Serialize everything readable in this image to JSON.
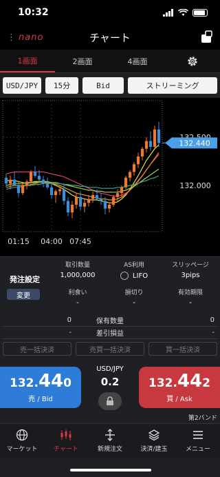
{
  "status": {
    "time": "10:32"
  },
  "header": {
    "logo": "nano",
    "title": "チャート"
  },
  "tabs": [
    {
      "label": "1画面"
    },
    {
      "label": "2画面"
    },
    {
      "label": "4画面"
    }
  ],
  "controls": {
    "pair": "USD/JPY",
    "interval": "15分",
    "price_type": "Bid",
    "streaming": "ストリーミング"
  },
  "chart_data": {
    "type": "candlestick",
    "y_tick_labels": [
      "132.500",
      "132.000"
    ],
    "y_ticks": [
      132.5,
      132.0
    ],
    "x_tick_labels": [
      "01:15",
      "04:00",
      "07:45"
    ],
    "current_price": "132.440",
    "ylim": [
      131.55,
      132.85
    ],
    "candles": [
      [
        132.08,
        132.12,
        131.98,
        132.02
      ],
      [
        132.02,
        132.1,
        131.96,
        132.06
      ],
      [
        132.06,
        132.14,
        132.0,
        132.0
      ],
      [
        132.0,
        132.04,
        131.88,
        131.92
      ],
      [
        131.92,
        132.02,
        131.9,
        132.0
      ],
      [
        132.0,
        132.06,
        131.96,
        132.04
      ],
      [
        132.04,
        132.16,
        132.02,
        132.14
      ],
      [
        132.14,
        132.2,
        132.08,
        132.1
      ],
      [
        132.1,
        132.16,
        132.04,
        132.06
      ],
      [
        132.06,
        132.1,
        131.98,
        132.02
      ],
      [
        132.02,
        132.08,
        131.96,
        131.98
      ],
      [
        131.98,
        132.02,
        131.86,
        131.9
      ],
      [
        131.9,
        131.96,
        131.82,
        131.94
      ],
      [
        131.94,
        132.0,
        131.9,
        131.96
      ],
      [
        131.96,
        132.02,
        131.8,
        131.84
      ],
      [
        131.84,
        131.88,
        131.68,
        131.72
      ],
      [
        131.72,
        131.84,
        131.66,
        131.8
      ],
      [
        131.8,
        131.92,
        131.76,
        131.88
      ],
      [
        131.88,
        131.94,
        131.74,
        131.78
      ],
      [
        131.78,
        131.86,
        131.72,
        131.82
      ],
      [
        131.82,
        131.9,
        131.78,
        131.86
      ],
      [
        131.86,
        131.94,
        131.82,
        131.9
      ],
      [
        131.9,
        131.96,
        131.84,
        131.86
      ],
      [
        131.86,
        131.92,
        131.8,
        131.84
      ],
      [
        131.84,
        131.88,
        131.7,
        131.76
      ],
      [
        131.76,
        131.82,
        131.72,
        131.8
      ],
      [
        131.8,
        131.9,
        131.78,
        131.88
      ],
      [
        131.88,
        131.96,
        131.84,
        131.92
      ],
      [
        131.92,
        132.0,
        131.88,
        131.98
      ],
      [
        131.98,
        132.1,
        131.96,
        132.08
      ],
      [
        132.08,
        132.16,
        132.04,
        132.14
      ],
      [
        132.14,
        132.24,
        132.1,
        132.22
      ],
      [
        132.22,
        132.34,
        132.18,
        132.3
      ],
      [
        132.3,
        132.4,
        132.26,
        132.38
      ],
      [
        132.38,
        132.5,
        132.34,
        132.46
      ],
      [
        132.46,
        132.56,
        132.36,
        132.4
      ],
      [
        132.4,
        132.62,
        132.38,
        132.58
      ],
      [
        132.58,
        132.66,
        132.4,
        132.44
      ]
    ],
    "ma_series": [
      {
        "color": "#e8e04a",
        "values": [
          132.05,
          132.05,
          132.05,
          132.04,
          132.03,
          132.02,
          132.03,
          132.04,
          132.04,
          132.04,
          132.03,
          132.02,
          132.0,
          131.98,
          131.96,
          131.93,
          131.9,
          131.88,
          131.87,
          131.86,
          131.85,
          131.85,
          131.85,
          131.84,
          131.83,
          131.82,
          131.82,
          131.83,
          131.86,
          131.9,
          131.96,
          132.03,
          132.1,
          132.18,
          132.26,
          132.32,
          132.38,
          132.42
        ]
      },
      {
        "color": "#e03a7a",
        "values": [
          132.12,
          132.13,
          132.14,
          132.14,
          132.14,
          132.14,
          132.14,
          132.14,
          132.14,
          132.14,
          132.13,
          132.12,
          132.11,
          132.1,
          132.09,
          132.07,
          132.05,
          132.03,
          132.01,
          131.99,
          131.97,
          131.95,
          131.93,
          131.92,
          131.91,
          131.9,
          131.89,
          131.89,
          131.9,
          131.92,
          131.95,
          131.99,
          132.04,
          132.1,
          132.16,
          132.22,
          132.27,
          132.32
        ]
      },
      {
        "color": "#e8942a",
        "values": [
          131.98,
          131.99,
          132.0,
          132.0,
          132.0,
          132.0,
          132.01,
          132.02,
          132.03,
          132.03,
          132.03,
          132.02,
          132.01,
          132.0,
          131.98,
          131.96,
          131.94,
          131.92,
          131.91,
          131.9,
          131.89,
          131.88,
          131.87,
          131.86,
          131.86,
          131.85,
          131.85,
          131.86,
          131.88,
          131.91,
          131.95,
          132.0,
          132.05,
          132.1,
          132.16,
          132.22,
          132.28,
          132.34
        ]
      },
      {
        "color": "#9ad84a",
        "values": [
          132.0,
          132.01,
          132.02,
          132.02,
          132.02,
          132.03,
          132.03,
          132.03,
          132.04,
          132.04,
          132.04,
          132.03,
          132.03,
          132.02,
          132.01,
          132.0,
          131.99,
          131.98,
          131.97,
          131.96,
          131.95,
          131.95,
          131.94,
          131.94,
          131.93,
          131.93,
          131.93,
          131.93,
          131.94,
          131.95,
          131.97,
          131.99,
          132.02,
          132.05,
          132.08,
          132.11,
          132.14,
          132.17
        ]
      },
      {
        "color": "#3fa88a",
        "values": [
          131.96,
          131.97,
          131.98,
          131.98,
          131.99,
          132.0,
          132.0,
          132.01,
          132.01,
          132.02,
          132.02,
          132.02,
          132.02,
          132.02,
          132.01,
          132.01,
          132.0,
          132.0,
          131.99,
          131.99,
          131.98,
          131.98,
          131.98,
          131.97,
          131.97,
          131.97,
          131.97,
          131.98,
          131.98,
          131.99,
          132.0,
          132.01,
          132.02,
          132.04,
          132.05,
          132.07,
          132.08,
          132.1
        ]
      }
    ]
  },
  "order_settings": {
    "title": "発注設定",
    "change": "変更",
    "quantity_label": "取引数量",
    "quantity_value": "1,000,000",
    "as_label": "AS利用",
    "as_value": "LIFO",
    "slippage_label": "スリッページ",
    "slippage_value": "3pips",
    "take_profit_label": "利食い",
    "take_profit_value": "-",
    "stop_loss_label": "損切り",
    "stop_loss_value": "-",
    "expiry_label": "有効期限",
    "expiry_value": "-"
  },
  "positions": {
    "left_qty": "0",
    "qty_label": "保有数量",
    "right_qty": "0",
    "left_pl": "-",
    "pl_label": "差引損益",
    "right_pl": "-"
  },
  "settle": {
    "sell_all": "売一括決済",
    "close_all": "売買一括決済",
    "buy_all": "買一括決済"
  },
  "trade": {
    "bid_prefix": "132.",
    "bid_big": "44",
    "bid_last": "0",
    "bid_label": "売 / Bid",
    "pair": "USD/JPY",
    "spread": "0.2",
    "ask_prefix": "132.",
    "ask_big": "44",
    "ask_last": "2",
    "ask_label": "買 / Ask",
    "band": "第2バンド"
  },
  "nav": [
    {
      "label": "マーケット"
    },
    {
      "label": "チャート"
    },
    {
      "label": "新規注文"
    },
    {
      "label": "決済/建玉"
    },
    {
      "label": "メニュー"
    }
  ]
}
